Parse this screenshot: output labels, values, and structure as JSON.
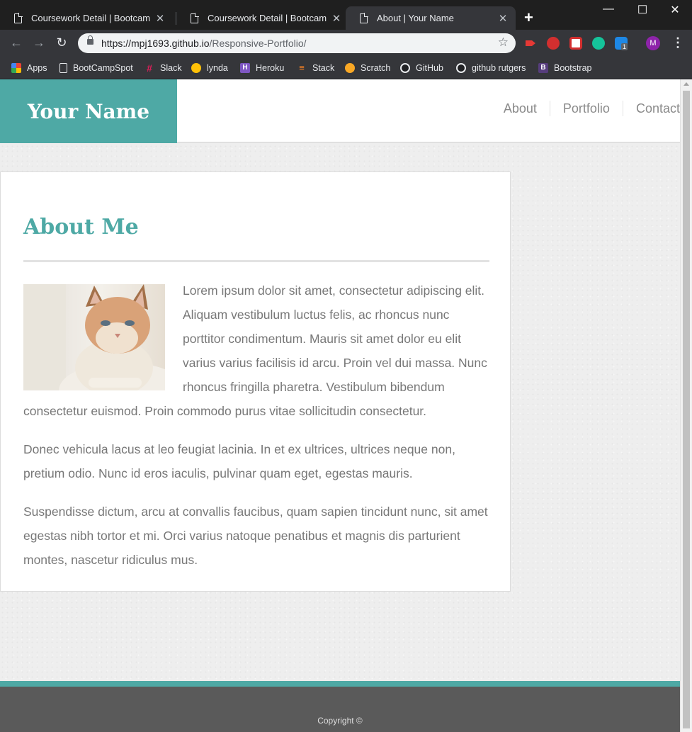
{
  "browser": {
    "tabs": [
      {
        "title": "Coursework Detail | Bootcamp Spot",
        "active": false
      },
      {
        "title": "Coursework Detail | Bootcamp Spot",
        "active": false
      },
      {
        "title": "About | Your Name",
        "active": true
      }
    ],
    "url_host": "https://mpj1693.github.io",
    "url_path": "/Responsive-Portfolio/",
    "avatar_letter": "M",
    "bookmarks": [
      {
        "label": "Apps",
        "icon": "apps-grid-icon"
      },
      {
        "label": "BootCampSpot",
        "icon": "page-icon"
      },
      {
        "label": "Slack",
        "icon": "slack-icon"
      },
      {
        "label": "lynda",
        "icon": "lynda-icon"
      },
      {
        "label": "Heroku",
        "icon": "heroku-icon"
      },
      {
        "label": "Stack",
        "icon": "stack-overflow-icon"
      },
      {
        "label": "Scratch",
        "icon": "scratch-icon"
      },
      {
        "label": "GitHub",
        "icon": "github-icon"
      },
      {
        "label": "github rutgers",
        "icon": "github-icon"
      },
      {
        "label": "Bootstrap",
        "icon": "bootstrap-icon"
      }
    ],
    "extension_badge": "1"
  },
  "site": {
    "brand": "Your Name",
    "nav": [
      "About",
      "Portfolio",
      "Contact"
    ],
    "about": {
      "title": "About Me",
      "image": "cat-photo",
      "paragraphs": [
        "Lorem ipsum dolor sit amet, consectetur adipiscing elit. Aliquam vestibulum luctus felis, ac rhoncus nunc porttitor condimentum. Mauris sit amet dolor eu elit varius varius facilisis id arcu. Proin vel dui massa. Nunc rhoncus fringilla pharetra. Vestibulum bibendum consectetur euismod. Proin commodo purus vitae sollicitudin consectetur.",
        "Donec vehicula lacus at leo feugiat lacinia. In et ex ultrices, ultrices neque non, pretium odio. Nunc id eros iaculis, pulvinar quam eget, egestas mauris.",
        "Suspendisse dictum, arcu at convallis faucibus, quam sapien tincidunt nunc, sit amet egestas nibh tortor et mi. Orci varius natoque penatibus et magnis dis parturient montes, nascetur ridiculus mus."
      ]
    },
    "footer": {
      "copyright": "Copyright ©"
    }
  },
  "colors": {
    "accent": "#4ea9a5",
    "footer": "#5a5a5a",
    "text": "#777777"
  }
}
